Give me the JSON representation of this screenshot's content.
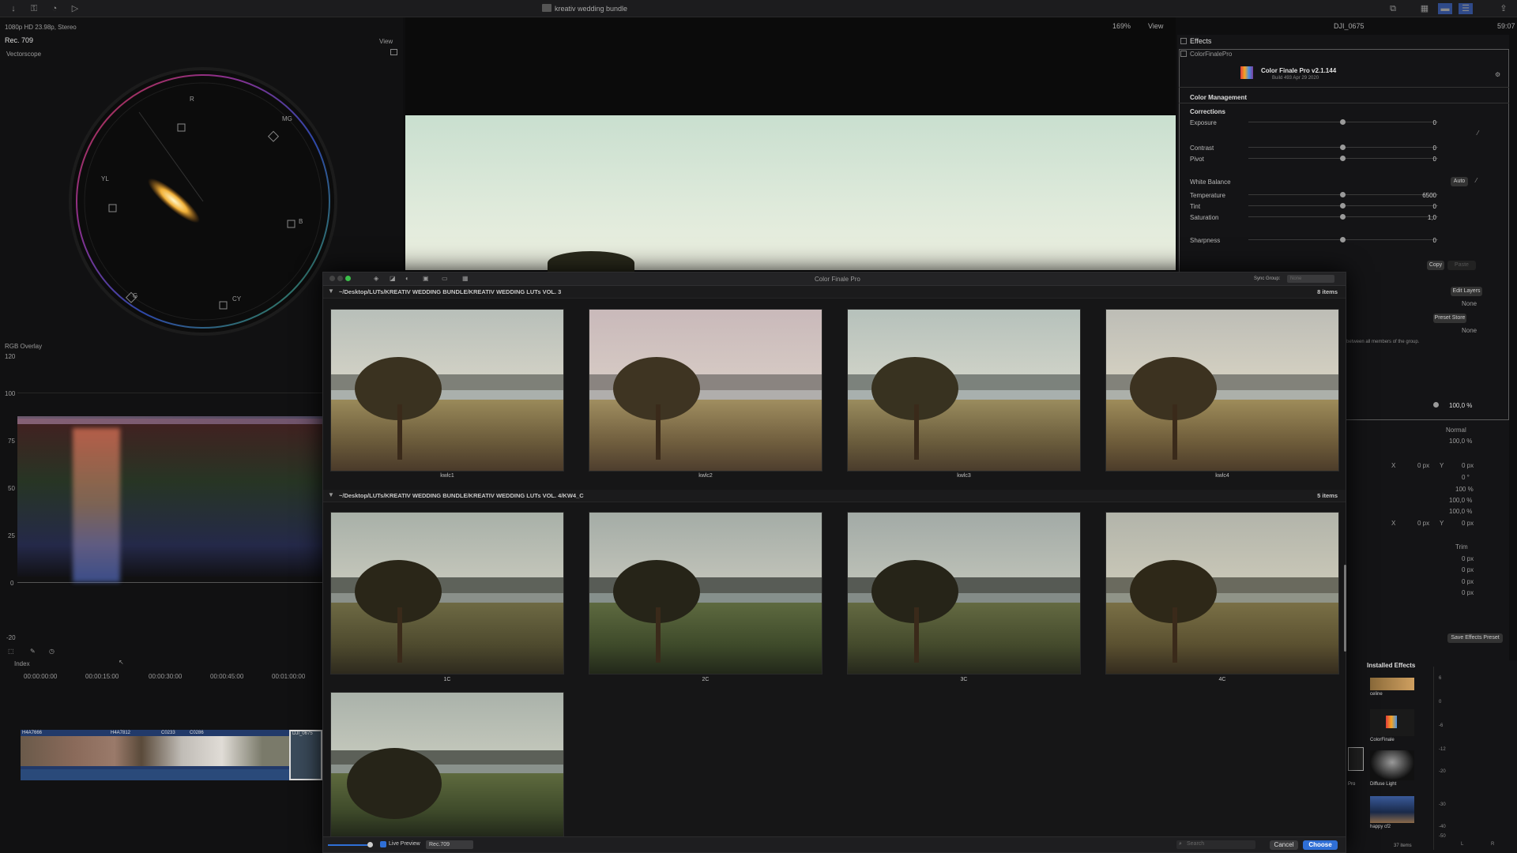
{
  "topbar": {
    "project_title": "kreativ wedding bundle",
    "zoom": "169%",
    "view_label": "View",
    "clip_name": "DJI_0675",
    "timecode": "59:07"
  },
  "scopes": {
    "format": "1080p HD 23.98p, Stereo",
    "colorspace": "Rec. 709",
    "view_label": "View",
    "vectorscope_label": "Vectorscope",
    "vectorscope_targets": [
      "R",
      "MG",
      "B",
      "CY",
      "G",
      "YL"
    ],
    "rgb_overlay_label": "RGB Overlay",
    "rgb_ticks": [
      "120",
      "100",
      "75",
      "50",
      "25",
      "0",
      "-20"
    ]
  },
  "inspector": {
    "effects_label": "Effects",
    "plugin_name": "ColorFinalePro",
    "plugin_title": "Color Finale Pro v2.1.144",
    "plugin_build": "Build 493 Apr 29 2020",
    "color_management": "Color Management",
    "corrections": "Corrections",
    "params": [
      {
        "name": "Exposure",
        "value": "0"
      },
      {
        "name": "Contrast",
        "value": "0"
      },
      {
        "name": "Pivot",
        "value": "0"
      },
      {
        "name": "White Balance",
        "value": "Auto"
      },
      {
        "name": "Temperature",
        "value": "6500"
      },
      {
        "name": "Tint",
        "value": "0"
      },
      {
        "name": "Saturation",
        "value": "1,0"
      },
      {
        "name": "Sharpness",
        "value": "0"
      }
    ],
    "copy_label": "Copy",
    "paste_label": "Paste",
    "edit_layers": "Edit Layers",
    "none1": "None",
    "preset_store": "Preset Store",
    "none2": "None",
    "group_note": "between all members of the group.",
    "opacity": "100,0 %",
    "blend_mode": "Normal",
    "blend_opacity": "100,0 %",
    "x_label": "X",
    "y_label": "Y",
    "pos_x": "0 px",
    "pos_y": "0 px",
    "rotation": "0 °",
    "scale_all": "100 %",
    "scale_x": "100,0 %",
    "scale_y": "100,0 %",
    "anchor_x": "0 px",
    "anchor_y": "0 px",
    "trim": "Trim",
    "trim_vals": [
      "0 px",
      "0 px",
      "0 px",
      "0 px"
    ],
    "save_preset": "Save Effects Preset"
  },
  "dialog": {
    "title": "Color Finale Pro",
    "sync_group": "Sync Group:",
    "sync_value": "None",
    "sections": [
      {
        "path": "~/Desktop/LUTs/KREATIV WEDDING BUNDLE/KREATIV WEDDING LUTs VOL. 3",
        "count": "8 items",
        "items": [
          "kwlc1",
          "kwlc2",
          "kwlc3",
          "kwlc4"
        ]
      },
      {
        "path": "~/Desktop/LUTs/KREATIV WEDDING BUNDLE/KREATIV WEDDING LUTs VOL. 4/KW4_C",
        "count": "5 items",
        "items": [
          "1C",
          "2C",
          "3C",
          "4C",
          ""
        ]
      }
    ],
    "live_preview": "Live Preview",
    "colorspace": "Rec.709",
    "search_placeholder": "Search",
    "cancel": "Cancel",
    "choose": "Choose"
  },
  "timeline": {
    "index_label": "Index",
    "timecodes": [
      "00:00:00:00",
      "00:00:15:00",
      "00:00:30:00",
      "00:00:45:00",
      "00:01:00:00"
    ],
    "clips": [
      "H4A7666",
      "H4A7812",
      "C0233",
      "C0286",
      "DJI_0675"
    ]
  },
  "effects_browser": {
    "title": "Installed Effects",
    "items": [
      "celine",
      "ColorFinale",
      "Diffuse Light",
      "happy cf2"
    ],
    "partial_label": "Pro",
    "count": "37 items",
    "meter_ticks": [
      "6",
      "0",
      "-6",
      "-12",
      "-20",
      "-30",
      "-40",
      "-50"
    ],
    "meter_lr": [
      "L",
      "R"
    ]
  },
  "colors": {
    "accent": "#2f6fd6",
    "green_light": "#3bbf4a",
    "bg": "#0e0e0f"
  }
}
